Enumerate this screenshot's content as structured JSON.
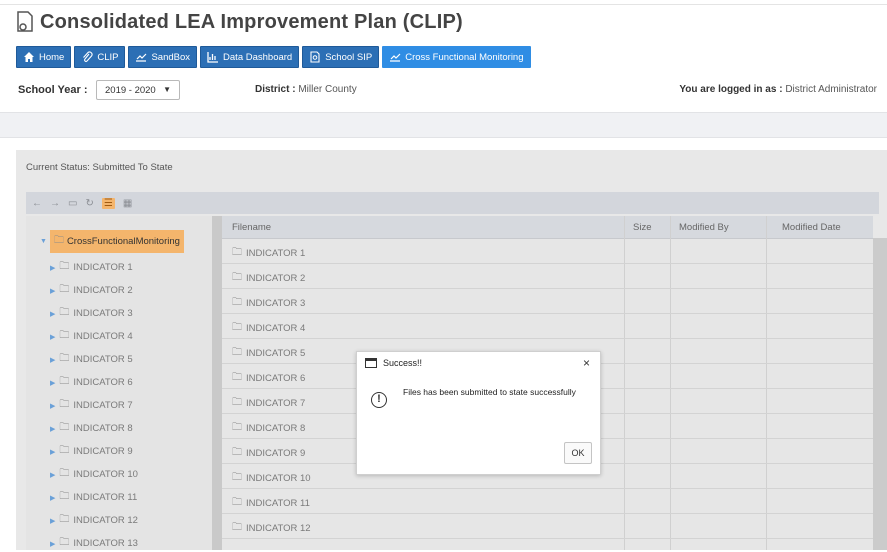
{
  "app": {
    "title": "Consolidated LEA Improvement Plan (CLIP)"
  },
  "nav": [
    {
      "label": "Home",
      "icon": "home-icon"
    },
    {
      "label": "CLIP",
      "icon": "paperclip-icon"
    },
    {
      "label": "SandBox",
      "icon": "sandbox-icon"
    },
    {
      "label": "Data Dashboard",
      "icon": "chart-icon"
    },
    {
      "label": "School SIP",
      "icon": "document-search-icon"
    },
    {
      "label": "Cross Functional Monitoring",
      "icon": "monitoring-icon"
    }
  ],
  "header": {
    "school_year_label": "School Year :",
    "school_year_value": "2019 - 2020",
    "district_label": "District :",
    "district_value": "Miller County",
    "logged_label": "You are logged in as :",
    "logged_value": "District Administrator"
  },
  "status": {
    "text": "Current Status:  Submitted To State"
  },
  "tree": {
    "root": "CrossFunctionalMonitoring",
    "items": [
      "INDICATOR 1",
      "INDICATOR 2",
      "INDICATOR 3",
      "INDICATOR 4",
      "INDICATOR 5",
      "INDICATOR 6",
      "INDICATOR 7",
      "INDICATOR 8",
      "INDICATOR 9",
      "INDICATOR 10",
      "INDICATOR 11",
      "INDICATOR 12",
      "INDICATOR 13"
    ]
  },
  "grid": {
    "columns": [
      "Filename",
      "Size",
      "Modified By",
      "Modified Date"
    ],
    "rows": [
      "INDICATOR 1",
      "INDICATOR 2",
      "INDICATOR 3",
      "INDICATOR 4",
      "INDICATOR 5",
      "INDICATOR 6",
      "INDICATOR 7",
      "INDICATOR 8",
      "INDICATOR 9",
      "INDICATOR 10",
      "INDICATOR 11",
      "INDICATOR 12"
    ]
  },
  "dialog": {
    "title": "Success!!",
    "message": "Files has been submitted to state successfully",
    "ok": "OK",
    "close": "×"
  },
  "colors": {
    "nav_blue": "#2c6fb5",
    "nav_active": "#2f8de4",
    "root_highlight": "#f4b56c"
  }
}
